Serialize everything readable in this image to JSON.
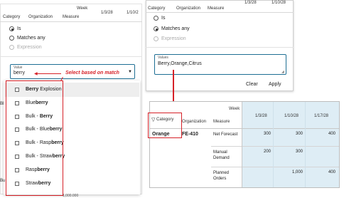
{
  "left_panel": {
    "week_label": "Week",
    "col_category": "Category",
    "col_organization": "Organization",
    "col_measure": "Measure",
    "date_1": "1/3/28",
    "date_2": "1/10/2",
    "radio_is": "Is",
    "radio_matches": "Matches any",
    "radio_expression": "Expression",
    "value_label": "Value",
    "value_text": "berry",
    "dropdown_items": [
      {
        "pre": "",
        "bold": "Berry",
        "post": " Explosion"
      },
      {
        "pre": "Blue",
        "bold": "berry",
        "post": ""
      },
      {
        "pre": "Bulk - ",
        "bold": "Berry",
        "post": ""
      },
      {
        "pre": "Bulk - Blue",
        "bold": "berry",
        "post": ""
      },
      {
        "pre": "Bulk - Rasp",
        "bold": "berry",
        "post": ""
      },
      {
        "pre": "Bulk - Straw",
        "bold": "berry",
        "post": ""
      },
      {
        "pre": "Rasp",
        "bold": "berry",
        "post": ""
      },
      {
        "pre": "Straw",
        "bold": "berry",
        "post": ""
      }
    ],
    "side_fragment_1": "Bl",
    "side_fragment_2": "Bu",
    "bottom_fragment": "1,000.000"
  },
  "callout_text": "Select based on match",
  "right_panel": {
    "col_category": "Category",
    "col_organization": "Organization",
    "col_measure": "Measure",
    "date_1": "1/3/28",
    "date_2": "1/10/28",
    "radio_is": "Is",
    "radio_matches": "Matches any",
    "radio_expression": "Expression",
    "value_label": "Values",
    "value_text": "Berry,Orange,Citrus",
    "clear_label": "Clear",
    "apply_label": "Apply"
  },
  "result_table": {
    "week_label": "Week",
    "filter_icon": "filter-icon",
    "col_category": "Category",
    "col_organization": "Organization",
    "col_measure": "Measure",
    "dates": [
      "1/3/28",
      "1/10/28",
      "1/17/28"
    ],
    "category_value": "Orange",
    "organization_value": "FE-410",
    "rows": [
      {
        "measure": "Net Forecast",
        "values": [
          "300",
          "300",
          "400"
        ]
      },
      {
        "measure": "Manual Demand",
        "values": [
          "200",
          "300",
          ""
        ]
      },
      {
        "measure": "Planned Orders",
        "values": [
          "",
          "1,000",
          "400"
        ]
      }
    ]
  },
  "colors": {
    "accent": "#1f6f94",
    "callout": "#d62128",
    "cell_highlight": "#deedf5"
  }
}
